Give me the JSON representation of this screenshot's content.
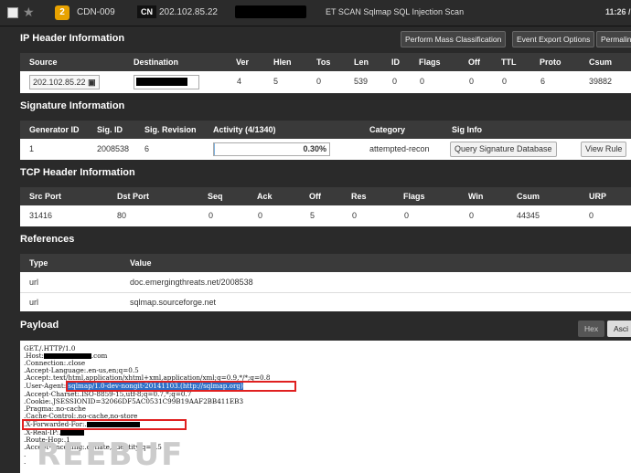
{
  "topbar": {
    "priority": "2",
    "sensor": "CDN-009",
    "country_code": "CN",
    "src_ip": "202.102.85.22",
    "signature": "ET SCAN Sqlmap SQL Injection Scan",
    "time": "11:26 /"
  },
  "ip_header": {
    "title": "IP Header Information",
    "buttons": [
      "Perform Mass Classification",
      "Event Export Options",
      "Permalin"
    ],
    "columns": [
      "Source",
      "Destination",
      "Ver",
      "Hlen",
      "Tos",
      "Len",
      "ID",
      "Flags",
      "Off",
      "TTL",
      "Proto",
      "Csum"
    ],
    "row": {
      "source": "202.102.85.22",
      "ver": "4",
      "hlen": "5",
      "tos": "0",
      "len": "539",
      "id": "0",
      "flags": "0",
      "off": "0",
      "ttl": "0",
      "proto": "6",
      "csum": "39882"
    }
  },
  "signature_info": {
    "title": "Signature Information",
    "columns": [
      "Generator ID",
      "Sig. ID",
      "Sig. Revision",
      "Activity (4/1340)",
      "Category",
      "Sig Info"
    ],
    "row": {
      "generator_id": "1",
      "sig_id": "2008538",
      "revision": "6",
      "activity": "0.30%",
      "activity_fraction": 0.003,
      "category": "attempted-recon",
      "query_button": "Query Signature Database",
      "view_rule_button": "View Rule"
    }
  },
  "tcp_header": {
    "title": "TCP Header Information",
    "columns": [
      "Src Port",
      "Dst Port",
      "Seq",
      "Ack",
      "Off",
      "Res",
      "Flags",
      "Win",
      "Csum",
      "URP"
    ],
    "row": {
      "src_port": "31416",
      "dst_port": "80",
      "seq": "0",
      "ack": "0",
      "off": "5",
      "res": "0",
      "flags": "0",
      "win": "0",
      "csum": "44345",
      "urp": "0"
    }
  },
  "references": {
    "title": "References",
    "columns": [
      "Type",
      "Value"
    ],
    "rows": [
      {
        "type": "url",
        "value": "doc.emergingthreats.net/2008538"
      },
      {
        "type": "url",
        "value": "sqlmap.sourceforge.net"
      }
    ]
  },
  "payload": {
    "title": "Payload",
    "hex_button": "Hex",
    "ascii_button": "Asci",
    "lines": {
      "l1": "GET./.HTTP/1.0",
      "host": ".Host:",
      "host_tail": ".com",
      "l3": ".Connection:.close",
      "l4": ".Accept-Language:.en-us,en;q=0.5",
      "l5": ".Accept:.text/html,application/xhtml+xml,application/xml;q=0.9,*/*;q=0.8",
      "ua_label": ".User-Agent:",
      "ua_value": ".sqlmap/1.0-dev-nongit-20141103.(http://sqlmap.org)",
      "l7": ".Accept-Charset:.ISO-8859-15,utf-8;q=0.7,*;q=0.7",
      "l8": ".Cookie:.JSESSIONID=32066DF5AC0531C99B19AAF2BB411EB3",
      "l9": ".Pragma:.no-cache",
      "l10": ".Cache-Control:.no-cache,no-store",
      "xff": ".X-Forwarded-For:.",
      "xreal": ".X-Real-IP:.",
      "l13": ".Route-Hop:.1",
      "l14": ".Accept-Encoding:.deflate,.identity;q=0.5",
      "l15": ".",
      "l16": "."
    },
    "watermark": "REEBUF"
  }
}
